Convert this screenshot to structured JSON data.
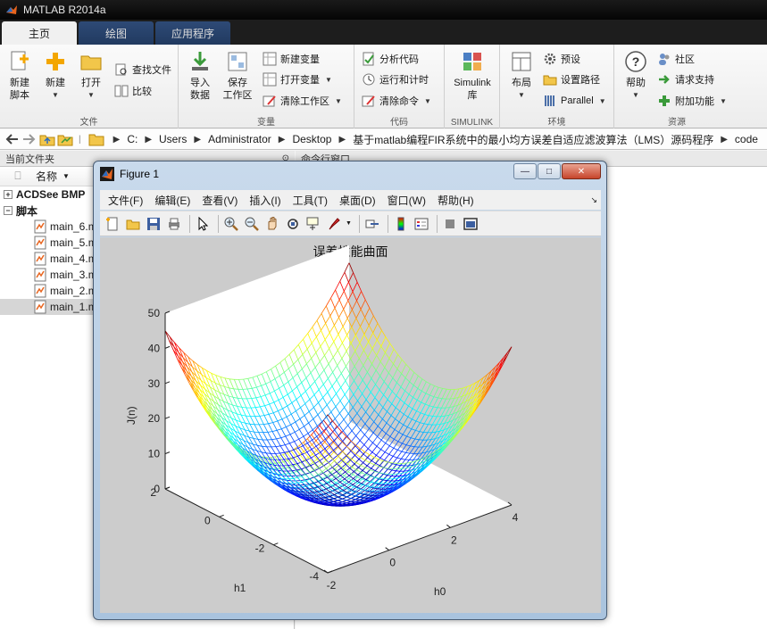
{
  "app": {
    "title": "MATLAB R2014a",
    "tabs": [
      {
        "label": "主页",
        "active": true
      },
      {
        "label": "绘图",
        "active": false
      },
      {
        "label": "应用程序",
        "active": false
      }
    ]
  },
  "ribbon": {
    "groups": {
      "file": "文件",
      "variable": "变量",
      "code": "代码",
      "simulink": "SIMULINK",
      "environment": "环境",
      "resources": "资源"
    },
    "new_script": [
      "新建",
      "脚本"
    ],
    "new": "新建",
    "open": "打开",
    "find_files": "查找文件",
    "compare": "比较",
    "import": [
      "导入",
      "数据"
    ],
    "save_ws": [
      "保存",
      "工作区"
    ],
    "new_var": "新建变量",
    "open_var": "打开变量",
    "clear_ws": "清除工作区",
    "analyze": "分析代码",
    "run_time": "运行和计时",
    "clear_cmd": "清除命令",
    "simulink": [
      "Simulink",
      "库"
    ],
    "layout": "布局",
    "preferences": "预设",
    "set_path": "设置路径",
    "parallel": "Parallel",
    "help": "帮助",
    "community": "社区",
    "support": "请求支持",
    "addons": "附加功能"
  },
  "address": {
    "segments": [
      "C:",
      "Users",
      "Administrator",
      "Desktop",
      "基于matlab编程FIR系统中的最小均方误差自适应滤波算法（LMS）源码程序",
      "code"
    ]
  },
  "file_panel": {
    "header": "当前文件夹",
    "column": "名称",
    "folders": [
      {
        "label": "ACDSee BMP",
        "expanded": false
      },
      {
        "label": "脚本",
        "expanded": true
      }
    ],
    "files": [
      {
        "label": "main_6.m",
        "selected": false
      },
      {
        "label": "main_5.m",
        "selected": false
      },
      {
        "label": "main_4.m",
        "selected": false
      },
      {
        "label": "main_3.m",
        "selected": false
      },
      {
        "label": "main_2.m",
        "selected": false
      },
      {
        "label": "main_1.m",
        "selected": true
      }
    ]
  },
  "command_panel": {
    "header": "命令行窗口"
  },
  "figure": {
    "title": "Figure 1",
    "menus": [
      "文件(F)",
      "编辑(E)",
      "查看(V)",
      "插入(I)",
      "工具(T)",
      "桌面(D)",
      "窗口(W)",
      "帮助(H)"
    ],
    "toolbar_icons": [
      "new-figure-icon",
      "open-icon",
      "save-icon",
      "print-icon",
      "pointer-icon",
      "zoom-in-icon",
      "zoom-out-icon",
      "pan-icon",
      "rotate-icon",
      "data-cursor-icon",
      "brush-icon",
      "link-icon",
      "colorbar-icon",
      "legend-icon",
      "hide-tools-icon",
      "dock-icon"
    ],
    "win_buttons": {
      "minimize": "—",
      "maximize": "□",
      "close": "✕"
    }
  },
  "chart_data": {
    "type": "surface-mesh",
    "title": "误差性能曲面",
    "xlabel": "h0",
    "ylabel": "h1",
    "zlabel": "J(n)",
    "x_ticks": [
      -2,
      0,
      2,
      4
    ],
    "y_ticks": [
      -4,
      -2,
      0,
      2
    ],
    "z_ticks": [
      0,
      10,
      20,
      30,
      40,
      50
    ],
    "xlim": [
      -2,
      4
    ],
    "ylim": [
      -4,
      2
    ],
    "zlim": [
      0,
      50
    ],
    "surface": "quadratic bowl J(h0,h1) with minimum near (h0=1,h1=-1), max ≈ 45 at corner (h0=-2,h1=2)",
    "colormap": "jet"
  }
}
